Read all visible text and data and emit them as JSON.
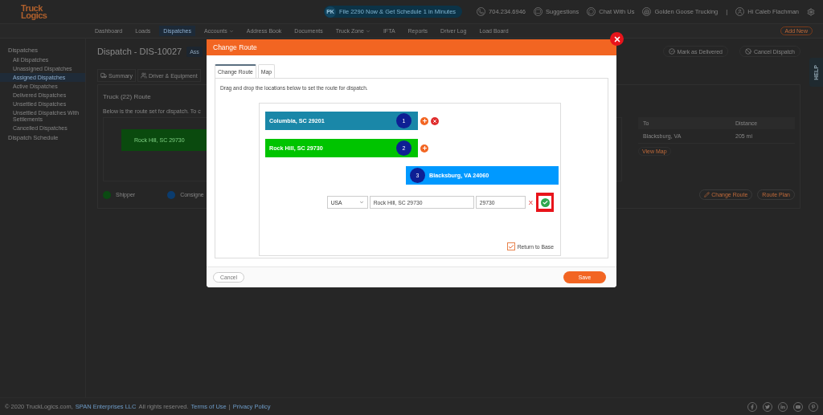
{
  "header": {
    "logo_lines": [
      "Truck",
      "Logics"
    ],
    "promo": {
      "badge": "PK",
      "text": "File 2290 Now & Get Schedule 1 in Minutes"
    },
    "phone": "704.234.6946",
    "suggestions": "Suggestions",
    "chat": "Chat With Us",
    "company": "Golden Goose Trucking",
    "separator": "|",
    "user": "Hi Caleb Flachman"
  },
  "nav": {
    "items": [
      {
        "label": "Dashboard",
        "selected": false,
        "dropdown": false
      },
      {
        "label": "Loads",
        "selected": false,
        "dropdown": false
      },
      {
        "label": "Dispatches",
        "selected": true,
        "dropdown": false
      },
      {
        "label": "Accounts",
        "selected": false,
        "dropdown": true
      },
      {
        "label": "Address Book",
        "selected": false,
        "dropdown": false
      },
      {
        "label": "Documents",
        "selected": false,
        "dropdown": false
      },
      {
        "label": "Truck Zone",
        "selected": false,
        "dropdown": true
      },
      {
        "label": "IFTA",
        "selected": false,
        "dropdown": false
      },
      {
        "label": "Reports",
        "selected": false,
        "dropdown": false
      },
      {
        "label": "Driver Log",
        "selected": false,
        "dropdown": false
      },
      {
        "label": "Load Board",
        "selected": false,
        "dropdown": false
      }
    ],
    "add_button": "Add New"
  },
  "sidebar": {
    "heading": "Dispatches",
    "items": [
      {
        "label": "All Dispatches",
        "selected": false
      },
      {
        "label": "Unassigned Dispatches",
        "selected": false
      },
      {
        "label": "Assigned Dispatches",
        "selected": true
      },
      {
        "label": "Active Dispatches",
        "selected": false
      },
      {
        "label": "Delivered Dispatches",
        "selected": false
      },
      {
        "label": "Unsettled Dispatches",
        "selected": false
      },
      {
        "label": "Unsettled Dispatches With Settlements",
        "selected": false
      },
      {
        "label": "Cancelled Dispatches",
        "selected": false
      }
    ],
    "schedule_link": "Dispatch Schedule"
  },
  "page": {
    "title": "Dispatch - DIS-10027",
    "status_badge": "Ass",
    "actions": [
      "Mark as Delivered",
      "Cancel Dispatch"
    ],
    "tabs": [
      {
        "label": "Summary",
        "selected": false
      },
      {
        "label": "Driver & Equipment",
        "selected": false
      }
    ],
    "route_card": {
      "title": "Truck (22) Route",
      "description": "Below is the route set for dispatch. To c",
      "stop": "Rock Hill, SC 29730",
      "table": {
        "columns": [
          "To",
          "Distance"
        ],
        "rows": [
          [
            "Blacksburg, VA",
            "205 mi"
          ]
        ]
      },
      "view_map": "View Map",
      "legend": [
        {
          "label": "Shipper",
          "color": "#0b4a12"
        },
        {
          "label": "Consigne",
          "color": "#0b3c6e"
        }
      ],
      "buttons": [
        "Change Route",
        "Route Plan"
      ]
    }
  },
  "help_tab": "HELP",
  "footer": {
    "copyright": "© 2020 TruckLogics.com,",
    "company_link": "SPAN Enterprises LLC",
    "rights": "All rights reserved.",
    "links": [
      "Terms of Use",
      "Privacy Policy"
    ],
    "separator": "|"
  },
  "modal": {
    "title": "Change Route",
    "tabs": [
      {
        "label": "Change Route",
        "selected": true
      },
      {
        "label": "Map",
        "selected": false
      }
    ],
    "instructions": "Drag and drop the locations below to set the route for dispatch.",
    "stops": [
      {
        "number": "1",
        "label": "Columbia, SC 29201",
        "color": "#1a87a8",
        "kind": "stop",
        "removable": true
      },
      {
        "number": "2",
        "label": "Rock Hill, SC 29730",
        "color": "#00c400",
        "kind": "stop",
        "removable": false
      },
      {
        "number": "3",
        "label": "Blacksburg, VA 24060",
        "color": "#0099ff",
        "kind": "destination",
        "removable": false
      }
    ],
    "form": {
      "country": "USA",
      "address": "Rock Hill, SC 29730",
      "zip": "29730",
      "cancel_mark": "X",
      "confirm_highlighted": true
    },
    "return_to_base": {
      "label": "Return to Base",
      "checked": true
    },
    "cancel_button": "Cancel",
    "save_button": "Save"
  }
}
